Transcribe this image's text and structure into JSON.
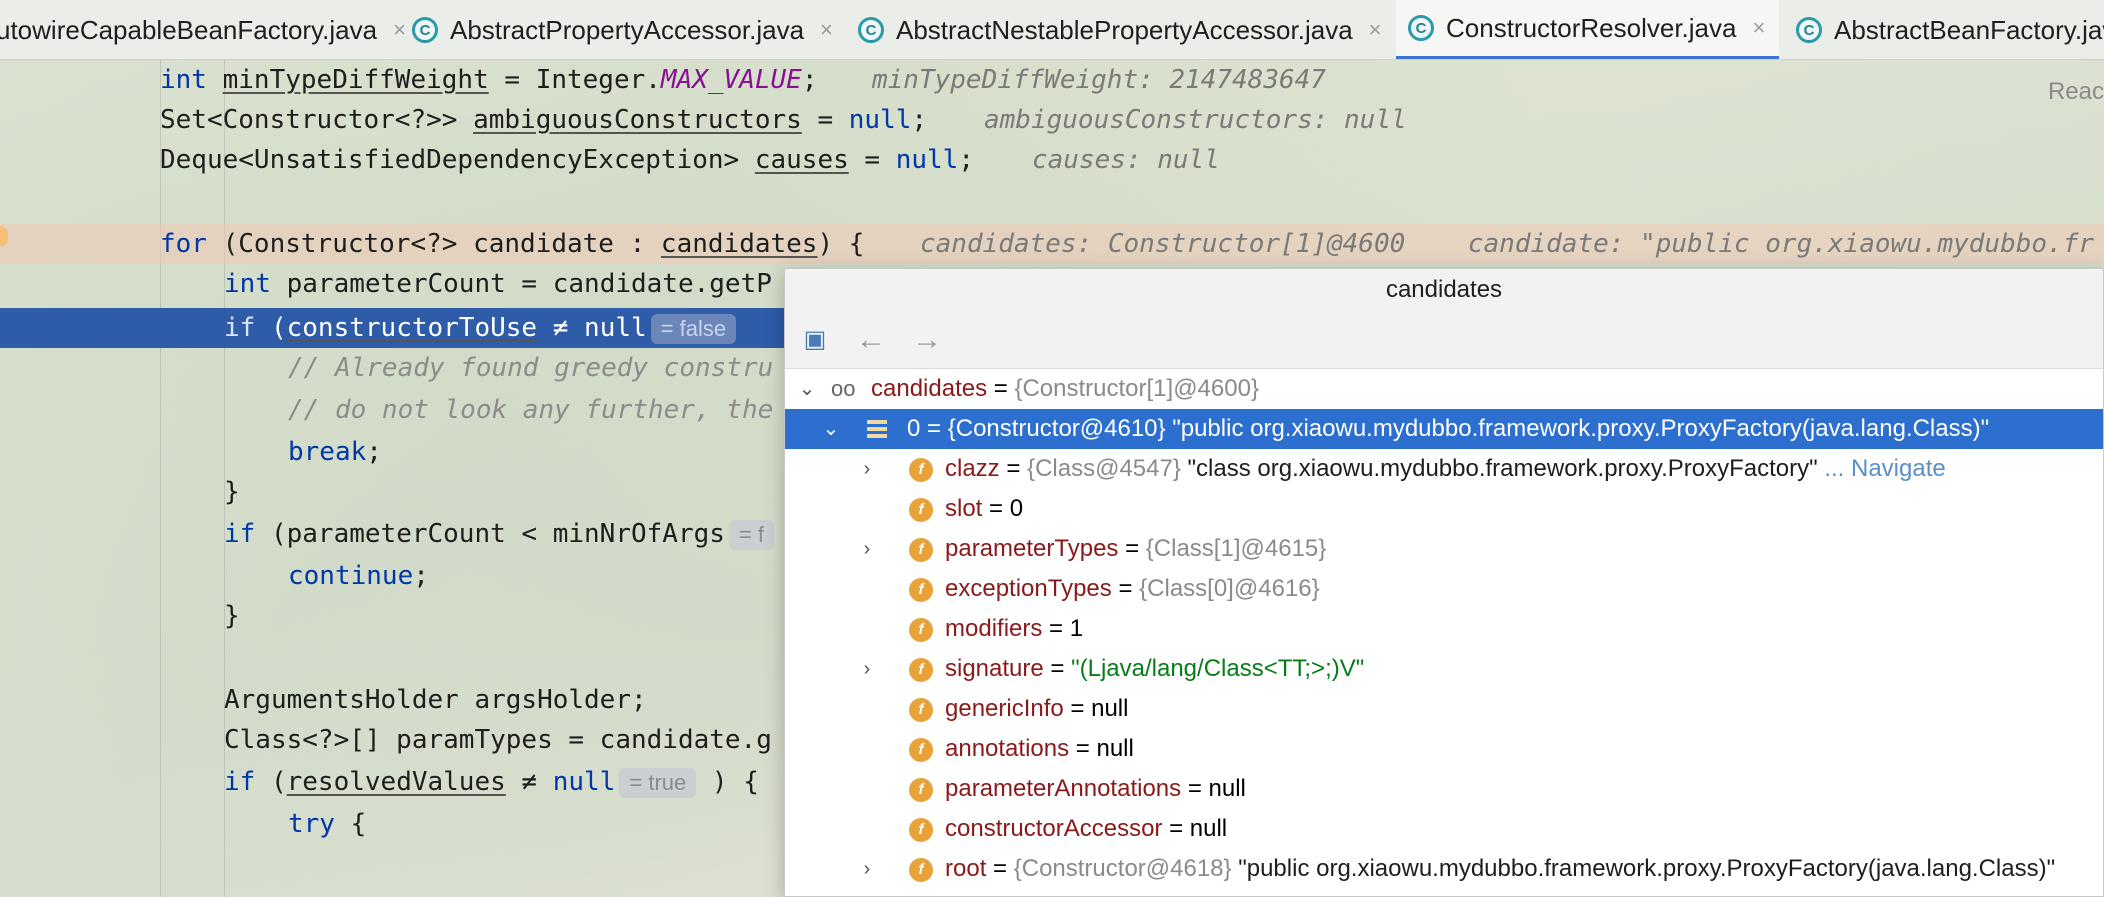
{
  "tabs": [
    {
      "label": "utowireCapableBeanFactory.java",
      "active": false,
      "icon": "class-icon"
    },
    {
      "label": "AbstractPropertyAccessor.java",
      "active": false,
      "icon": "class-icon"
    },
    {
      "label": "AbstractNestablePropertyAccessor.java",
      "active": false,
      "icon": "class-icon"
    },
    {
      "label": "ConstructorResolver.java",
      "active": true,
      "icon": "class-icon"
    },
    {
      "label": "AbstractBeanFactory.java",
      "active": false,
      "icon": "class-icon"
    }
  ],
  "tab_close_glyph": "×",
  "tab_icon_letter": "C",
  "reader_hint": "Reac",
  "code": {
    "l1": {
      "a": "int ",
      "b": "minTypeDiffWeight",
      "c": " = Integer.",
      "d": "MAX_VALUE",
      "e": ";",
      "hint": "minTypeDiffWeight: 2147483647"
    },
    "l2": {
      "a": "Set<Constructor<?>> ",
      "b": "ambiguousConstructors",
      "c": " = ",
      "d": "null",
      "e": ";",
      "hint": "ambiguousConstructors: null"
    },
    "l3": {
      "a": "Deque<UnsatisfiedDependencyException> ",
      "b": "causes",
      "c": " = ",
      "d": "null",
      "e": ";",
      "hint": "causes: null"
    },
    "l4": {
      "a": "for",
      "b": " (Constructor<?> candidate : ",
      "c": "candidates",
      "d": ") {",
      "hint": "candidates: Constructor[1]@4600    candidate: \"public org.xiaowu.mydubbo.fr"
    },
    "l5": {
      "a": "int",
      "b": " parameterCount = candidate.getP"
    },
    "l6": {
      "a": "if",
      "b": " (",
      "c": "constructorToUse",
      "d": " ≠ null",
      "badge": "= false"
    },
    "l7": {
      "text": "// Already found greedy constru"
    },
    "l8": {
      "text": "// do not look any further, the"
    },
    "l9": {
      "a": "break",
      "b": ";"
    },
    "l10": {
      "text": "}"
    },
    "l11": {
      "a": "if",
      "b": " (parameterCount < minNrOfArgs",
      "badge": "= f"
    },
    "l12": {
      "a": "continue",
      "b": ";"
    },
    "l13": {
      "text": "}"
    },
    "l14": {
      "text": "ArgumentsHolder argsHolder;"
    },
    "l15": {
      "text": "Class<?>[] paramTypes = candidate.g"
    },
    "l16": {
      "a": "if",
      "b": " (",
      "c": "resolvedValues",
      "d": " ≠ ",
      "e": "null",
      "badge": "= true",
      "f": " ) {"
    },
    "l17": {
      "a": "try",
      "b": " {"
    }
  },
  "popup": {
    "title": "candidates",
    "toolbar": {
      "folder": "▣",
      "back": "←",
      "forward": "→"
    },
    "arrows": {
      "expanded": "⌄",
      "collapsed": "›"
    },
    "watch_glyph": "oo",
    "field_badge": "f",
    "nodes": [
      {
        "name": "candidates",
        "eq": " = ",
        "ref": "{Constructor[1]@4600}",
        "value": ""
      },
      {
        "name": "0",
        "eq": " = ",
        "ref": "{Constructor@4610}",
        "value": " \"public org.xiaowu.mydubbo.framework.proxy.ProxyFactory(java.lang.Class)\""
      },
      {
        "name": "clazz",
        "eq": " = ",
        "ref": "{Class@4547}",
        "value": " \"class org.xiaowu.mydubbo.framework.proxy.ProxyFactory\"",
        "nav": " ... Navigate"
      },
      {
        "name": "slot",
        "eq": " = ",
        "ref": "",
        "value": "0"
      },
      {
        "name": "parameterTypes",
        "eq": " = ",
        "ref": "{Class[1]@4615}",
        "value": ""
      },
      {
        "name": "exceptionTypes",
        "eq": " = ",
        "ref": "{Class[0]@4616}",
        "value": ""
      },
      {
        "name": "modifiers",
        "eq": " = ",
        "ref": "",
        "value": "1"
      },
      {
        "name": "signature",
        "eq": " = ",
        "ref": "",
        "value": "\"(Ljava/lang/Class<TT;>;)V\""
      },
      {
        "name": "genericInfo",
        "eq": " = ",
        "ref": "",
        "value": "null"
      },
      {
        "name": "annotations",
        "eq": " = ",
        "ref": "",
        "value": "null"
      },
      {
        "name": "parameterAnnotations",
        "eq": " = ",
        "ref": "",
        "value": "null"
      },
      {
        "name": "constructorAccessor",
        "eq": " = ",
        "ref": "",
        "value": "null"
      },
      {
        "name": "root",
        "eq": " = ",
        "ref": "{Constructor@4618}",
        "value": " \"public org.xiaowu.mydubbo.framework.proxy.ProxyFactory(java.lang.Class)\""
      }
    ]
  },
  "colors": {
    "selection": "#2c6fcf",
    "exec_line": "#2e5ca8",
    "keyword": "#0037a6",
    "field": "#871094",
    "string_green": "#067d17",
    "tab_underline": "#3b74d6"
  }
}
